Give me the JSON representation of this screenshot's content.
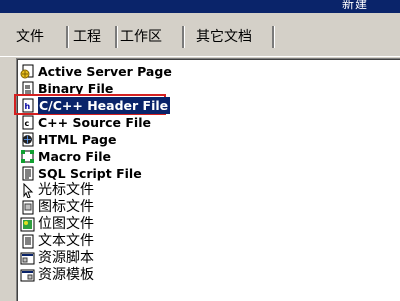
{
  "window": {
    "title_fragment": "新建"
  },
  "tabs": [
    {
      "label": "文件"
    },
    {
      "label": "工程"
    },
    {
      "label": "工作区"
    },
    {
      "label": "其它文档"
    }
  ],
  "file_types": [
    {
      "label": "Active Server Page",
      "icon": "asp-page-icon"
    },
    {
      "label": "Binary File",
      "icon": "binary-file-icon"
    },
    {
      "label": "C/C++ Header File",
      "icon": "header-file-icon",
      "selected": true
    },
    {
      "label": "C++ Source File",
      "icon": "cpp-source-icon"
    },
    {
      "label": "HTML Page",
      "icon": "html-page-icon"
    },
    {
      "label": "Macro File",
      "icon": "macro-file-icon"
    },
    {
      "label": "SQL Script File",
      "icon": "sql-script-icon"
    },
    {
      "label": "光标文件",
      "icon": "cursor-file-icon"
    },
    {
      "label": "图标文件",
      "icon": "icon-file-icon"
    },
    {
      "label": "位图文件",
      "icon": "bitmap-file-icon"
    },
    {
      "label": "文本文件",
      "icon": "text-file-icon"
    },
    {
      "label": "资源脚本",
      "icon": "resource-script-icon"
    },
    {
      "label": "资源模板",
      "icon": "resource-template-icon"
    }
  ],
  "colors": {
    "dialog_face": "#d4d0c8",
    "title_bar": "#0a246a",
    "selection": "#0a246a",
    "annotation_box": "#d42020"
  }
}
